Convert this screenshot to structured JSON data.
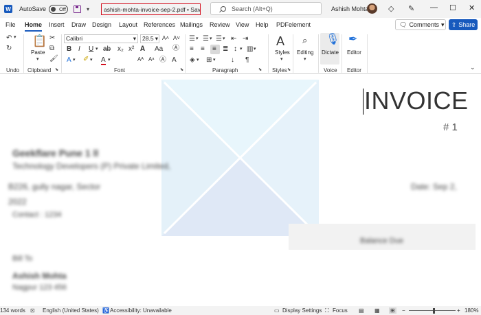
{
  "titlebar": {
    "app_letter": "W",
    "autosave_label": "AutoSave",
    "autosave_state": "Off",
    "document_name": "ashish-mohta-invoice-sep-2.pdf • Saved",
    "search_placeholder": "Search (Alt+Q)",
    "user_name": "Ashish Mohta"
  },
  "menu": {
    "tabs": [
      "File",
      "Home",
      "Insert",
      "Draw",
      "Design",
      "Layout",
      "References",
      "Mailings",
      "Review",
      "View",
      "Help",
      "PDFelement"
    ],
    "active_tab": "Home",
    "comments_label": "Comments",
    "share_label": "Share"
  },
  "ribbon": {
    "font_name": "Calibri",
    "font_size": "28.5",
    "paste_label": "Paste",
    "styles_label": "Styles",
    "editing_label": "Editing",
    "dictate_label": "Dictate",
    "editor_label": "Editor",
    "groups": {
      "undo": "Undo",
      "clipboard": "Clipboard",
      "font": "Font",
      "paragraph": "Paragraph",
      "styles": "Styles",
      "voice": "Voice",
      "editor": "Editor"
    }
  },
  "document": {
    "title": "INVOICE",
    "number": "# 1",
    "blurred_lines": [
      "Geekflare Pune 1 ll",
      "Technology Developers (P) Private Limited,",
      "B226, gully nagar, Sector",
      "2022",
      "Contact : 1234",
      "Date: Sep 2,",
      "Balance Due",
      "Bill To",
      "Ashish Mohta",
      "Nagpur 123 456"
    ]
  },
  "status": {
    "words": "134 words",
    "language": "English (United States)",
    "accessibility": "Accessibility: Unavailable",
    "display_settings": "Display Settings",
    "focus": "Focus",
    "zoom": "180%"
  },
  "colors": {
    "accent": "#185abd",
    "highlight_border": "#d4101f",
    "placeholder_top": "#e8f6fc",
    "placeholder_bottom": "#dfe8f6"
  }
}
